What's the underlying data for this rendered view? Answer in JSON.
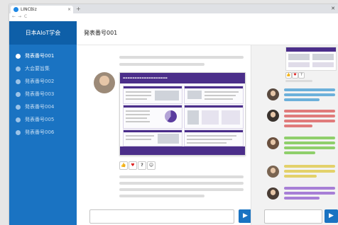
{
  "browser": {
    "tab_title": "LINCBiz",
    "close_tab": "×",
    "new_tab": "+",
    "window_close": "✕",
    "back": "←",
    "forward": "→",
    "reload": "C"
  },
  "sidebar": {
    "title": "日本AIoT学会",
    "items": [
      {
        "label": "発表番号001",
        "active": true
      },
      {
        "label": "大会要旨集",
        "active": false
      },
      {
        "label": "発表番号002",
        "active": false
      },
      {
        "label": "発表番号003",
        "active": false
      },
      {
        "label": "発表番号004",
        "active": false
      },
      {
        "label": "発表番号005",
        "active": false
      },
      {
        "label": "発表番号006",
        "active": false
      }
    ]
  },
  "header": {
    "title": "発表番号001"
  },
  "reactions": {
    "thumbs_up": "👍",
    "heart": "♥",
    "question": "?",
    "smile": "☺"
  },
  "composer": {
    "send_icon": "▶"
  },
  "colors": {
    "sidebar_bg": "#1a73c2",
    "sidebar_header_bg": "#0e5fa8",
    "poster_accent": "#4b2e8a",
    "comment_blue": "#6cb0da",
    "comment_red": "#e07b7b",
    "comment_green": "#8fcf6b",
    "comment_yellow": "#e3d16a",
    "comment_purple": "#a77fd6"
  }
}
